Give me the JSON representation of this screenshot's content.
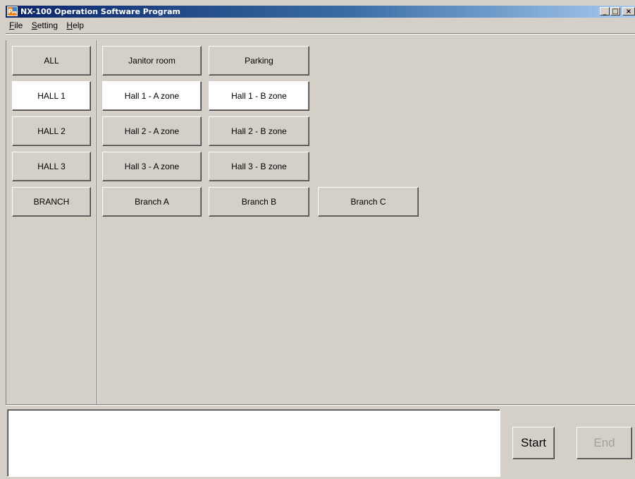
{
  "window": {
    "title": "NX-100 Operation Software Program",
    "app_icon_text": "PA",
    "minimize": "_",
    "maximize": "□",
    "close": "×"
  },
  "menu": [
    {
      "label": "File",
      "mnemonic": "F",
      "rest": "ile"
    },
    {
      "label": "Setting",
      "mnemonic": "S",
      "rest": "etting"
    },
    {
      "label": "Help",
      "mnemonic": "H",
      "rest": "elp"
    }
  ],
  "groups": [
    {
      "label": "ALL",
      "selected": false
    },
    {
      "label": "HALL 1",
      "selected": true
    },
    {
      "label": "HALL 2",
      "selected": false
    },
    {
      "label": "HALL 3",
      "selected": false
    },
    {
      "label": "BRANCH",
      "selected": false
    }
  ],
  "zones": {
    "row_all": [
      "Janitor room",
      "Parking"
    ],
    "row_hall1": [
      "Hall 1 - A zone",
      "Hall 1 - B zone"
    ],
    "row_hall2": [
      "Hall 2 - A zone",
      "Hall 2 - B zone"
    ],
    "row_hall3": [
      "Hall 3 - A zone",
      "Hall 3 - B zone"
    ],
    "row_branch": [
      "Branch A",
      "Branch B",
      "Branch C"
    ]
  },
  "controls": {
    "start_label": "Start",
    "end_label": "End",
    "status_text": ""
  }
}
